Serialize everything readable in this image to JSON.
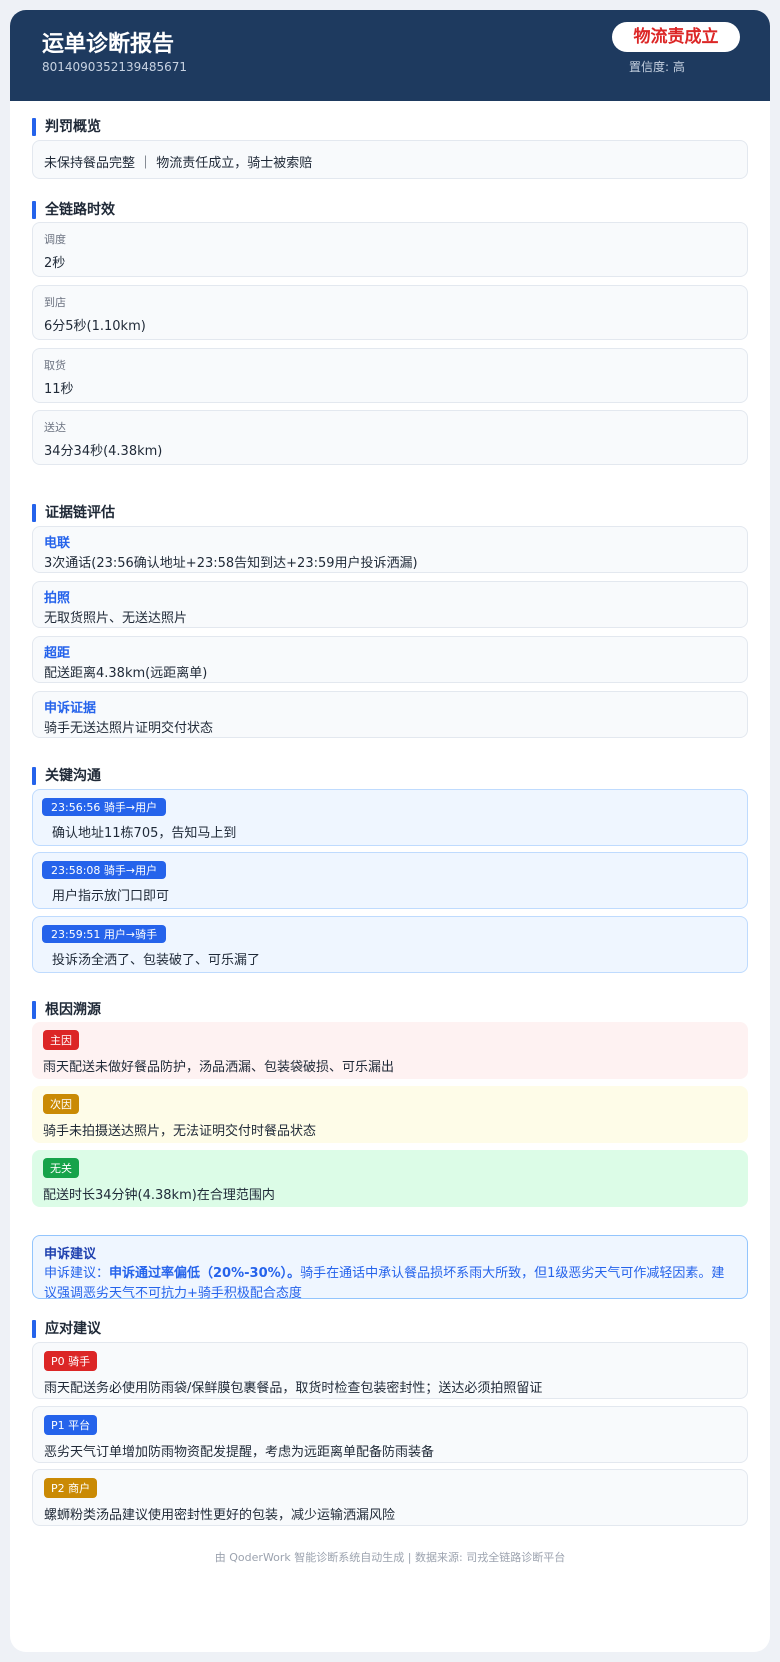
{
  "header": {
    "title": "运单诊断报告",
    "order_id": "8014090352139485671",
    "verdict": "物流责成立",
    "confidence": "置信度: 高"
  },
  "overview": {
    "title": "判罚概览",
    "text": "未保持餐品完整 ｜ 物流责任成立，骑士被索赔"
  },
  "timing": {
    "title": "全链路时效",
    "items": [
      {
        "label": "调度",
        "value": "2秒"
      },
      {
        "label": "到店",
        "value": "6分5秒(1.10km)"
      },
      {
        "label": "取货",
        "value": "11秒"
      },
      {
        "label": "送达",
        "value": "34分34秒(4.38km)"
      }
    ]
  },
  "evidence": {
    "title": "证据链评估",
    "items": [
      {
        "label": "电联",
        "value": "3次通话(23:56确认地址+23:58告知到达+23:59用户投诉洒漏)"
      },
      {
        "label": "拍照",
        "value": "无取货照片、无送达照片"
      },
      {
        "label": "超距",
        "value": "配送距离4.38km(远距离单)"
      },
      {
        "label": "申诉证据",
        "value": "骑手无送达照片证明交付状态"
      }
    ]
  },
  "comms": {
    "title": "关键沟通",
    "items": [
      {
        "tag": "23:56:56  骑手→用户",
        "text": "确认地址11栋705，告知马上到"
      },
      {
        "tag": "23:58:08  骑手→用户",
        "text": "用户指示放门口即可"
      },
      {
        "tag": "23:59:51  用户→骑手",
        "text": "投诉汤全洒了、包装破了、可乐漏了"
      }
    ]
  },
  "causes": {
    "title": "根因溯源",
    "items": [
      {
        "tag": "主因",
        "text": "雨天配送未做好餐品防护，汤品洒漏、包装袋破损、可乐漏出"
      },
      {
        "tag": "次因",
        "text": "骑手未拍摄送达照片，无法证明交付时餐品状态"
      },
      {
        "tag": "无关",
        "text": "配送时长34分钟(4.38km)在合理范围内"
      }
    ]
  },
  "appeal": {
    "title": "申诉建议",
    "prefix": "申诉建议：",
    "bold": "申诉通过率偏低（20%-30%）。",
    "rest": "骑手在通话中承认餐品损坏系雨大所致，但1级恶劣天气可作减轻因素。建议强调恶劣天气不可抗力+骑手积极配合态度"
  },
  "actions": {
    "title": "应对建议",
    "items": [
      {
        "tag": "P0 骑手",
        "text": "雨天配送务必使用防雨袋/保鲜膜包裹餐品，取货时检查包装密封性；送达必须拍照留证"
      },
      {
        "tag": "P1 平台",
        "text": "恶劣天气订单增加防雨物资配发提醒，考虑为远距离单配备防雨装备"
      },
      {
        "tag": "P2 商户",
        "text": "螺蛳粉类汤品建议使用密封性更好的包装，减少运输洒漏风险"
      }
    ]
  },
  "footer": "由 QoderWork 智能诊断系统自动生成 | 数据来源: 司戎全链路诊断平台",
  "colors": {
    "header_bg": "#1e3a5f",
    "accent": "#2563eb",
    "danger": "#dc2626",
    "warning": "#ca8a04",
    "success": "#16a34a"
  }
}
